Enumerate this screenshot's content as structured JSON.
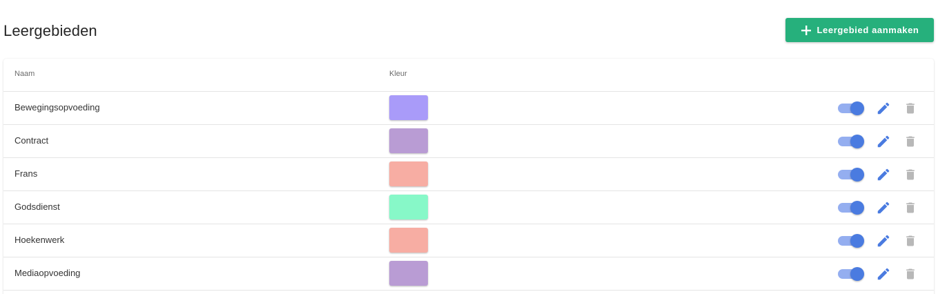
{
  "page": {
    "title": "Leergebieden"
  },
  "toolbar": {
    "create_label": "Leergebied aanmaken",
    "create_icon": "plus-icon",
    "button_color": "#26b07c"
  },
  "table": {
    "columns": [
      "Naam",
      "Kleur"
    ],
    "rows": [
      {
        "name": "Bewegingsopvoeding",
        "color": "#a99bf9",
        "active": true
      },
      {
        "name": "Contract",
        "color": "#b99cd4",
        "active": true
      },
      {
        "name": "Frans",
        "color": "#f7ada3",
        "active": true
      },
      {
        "name": "Godsdienst",
        "color": "#87f8c8",
        "active": true
      },
      {
        "name": "Hoekenwerk",
        "color": "#f7ada3",
        "active": true
      },
      {
        "name": "Mediaopvoeding",
        "color": "#b99cd4",
        "active": true
      }
    ],
    "row_icons": [
      "edit-icon",
      "delete-icon"
    ],
    "toggle_color": "#4a7be0",
    "edit_icon_color": "#4a7be0",
    "delete_icon_color": "#b8b8b8"
  }
}
